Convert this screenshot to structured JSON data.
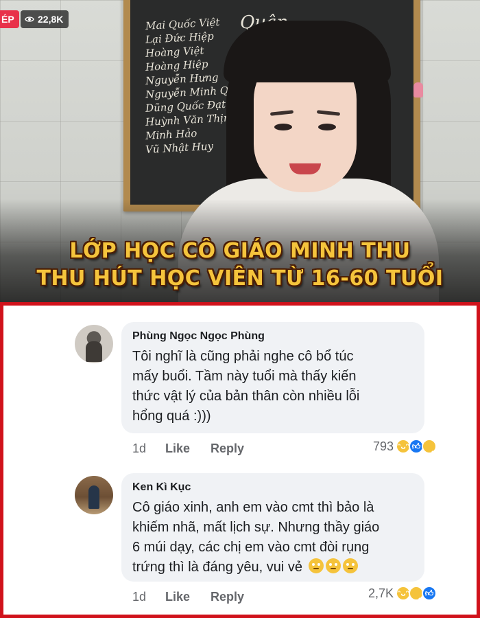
{
  "stream": {
    "live_label": "ÉP",
    "viewer_count": "22,8K",
    "board_names": [
      "Mai Quốc Việt",
      "Lại Đức Hiệp",
      "Hoàng Việt",
      "Hoàng Hiệp",
      "Nguyễn Hưng",
      "Nguyễn Minh Quân",
      "Dũng Quốc Đạt",
      "Huỳnh Văn Thịnh",
      "Minh Hảo",
      "Vũ Nhật Huy"
    ],
    "board_header": "Quân",
    "headline_line1": "LỚP HỌC CÔ GIÁO MINH THU",
    "headline_line2": "THU HÚT HỌC VIÊN TỪ 16-60 TUỔI"
  },
  "comments": [
    {
      "author": "Phùng Ngọc Ngọc Phùng",
      "text": "Tôi nghĩ là cũng phải nghe cô bổ túc\nmấy buổi. Tầm này tuổi mà thấy kiến\nthức vật lý của bản thân còn nhiều lỗi\nhổng quá :)))",
      "time": "1d",
      "like_label": "Like",
      "reply_label": "Reply",
      "reaction_count": "793",
      "reactions": [
        "haha-icon",
        "like-icon",
        "sad-icon"
      ]
    },
    {
      "author": "Ken Kì Kục",
      "text": "Cô giáo xinh, anh em vào cmt thì bảo là\nkhiếm nhã, mất lịch sự. Nhưng thầy giáo\n6 múi dạy, các chị em vào cmt đòi rụng\ntrứng thì là đáng yêu, vui vẻ",
      "time": "1d",
      "like_label": "Like",
      "reply_label": "Reply",
      "reaction_count": "2,7K",
      "reactions": [
        "haha-icon",
        "sad-icon",
        "like-icon"
      ],
      "inline_emojis": [
        "rolling-eyes-icon",
        "rolling-eyes-icon",
        "rolling-eyes-icon"
      ]
    }
  ],
  "colors": {
    "frame_red": "#d0121b",
    "headline_yellow": "#f5c43c",
    "bubble_bg": "#f0f2f5",
    "like_blue": "#1877f2"
  }
}
